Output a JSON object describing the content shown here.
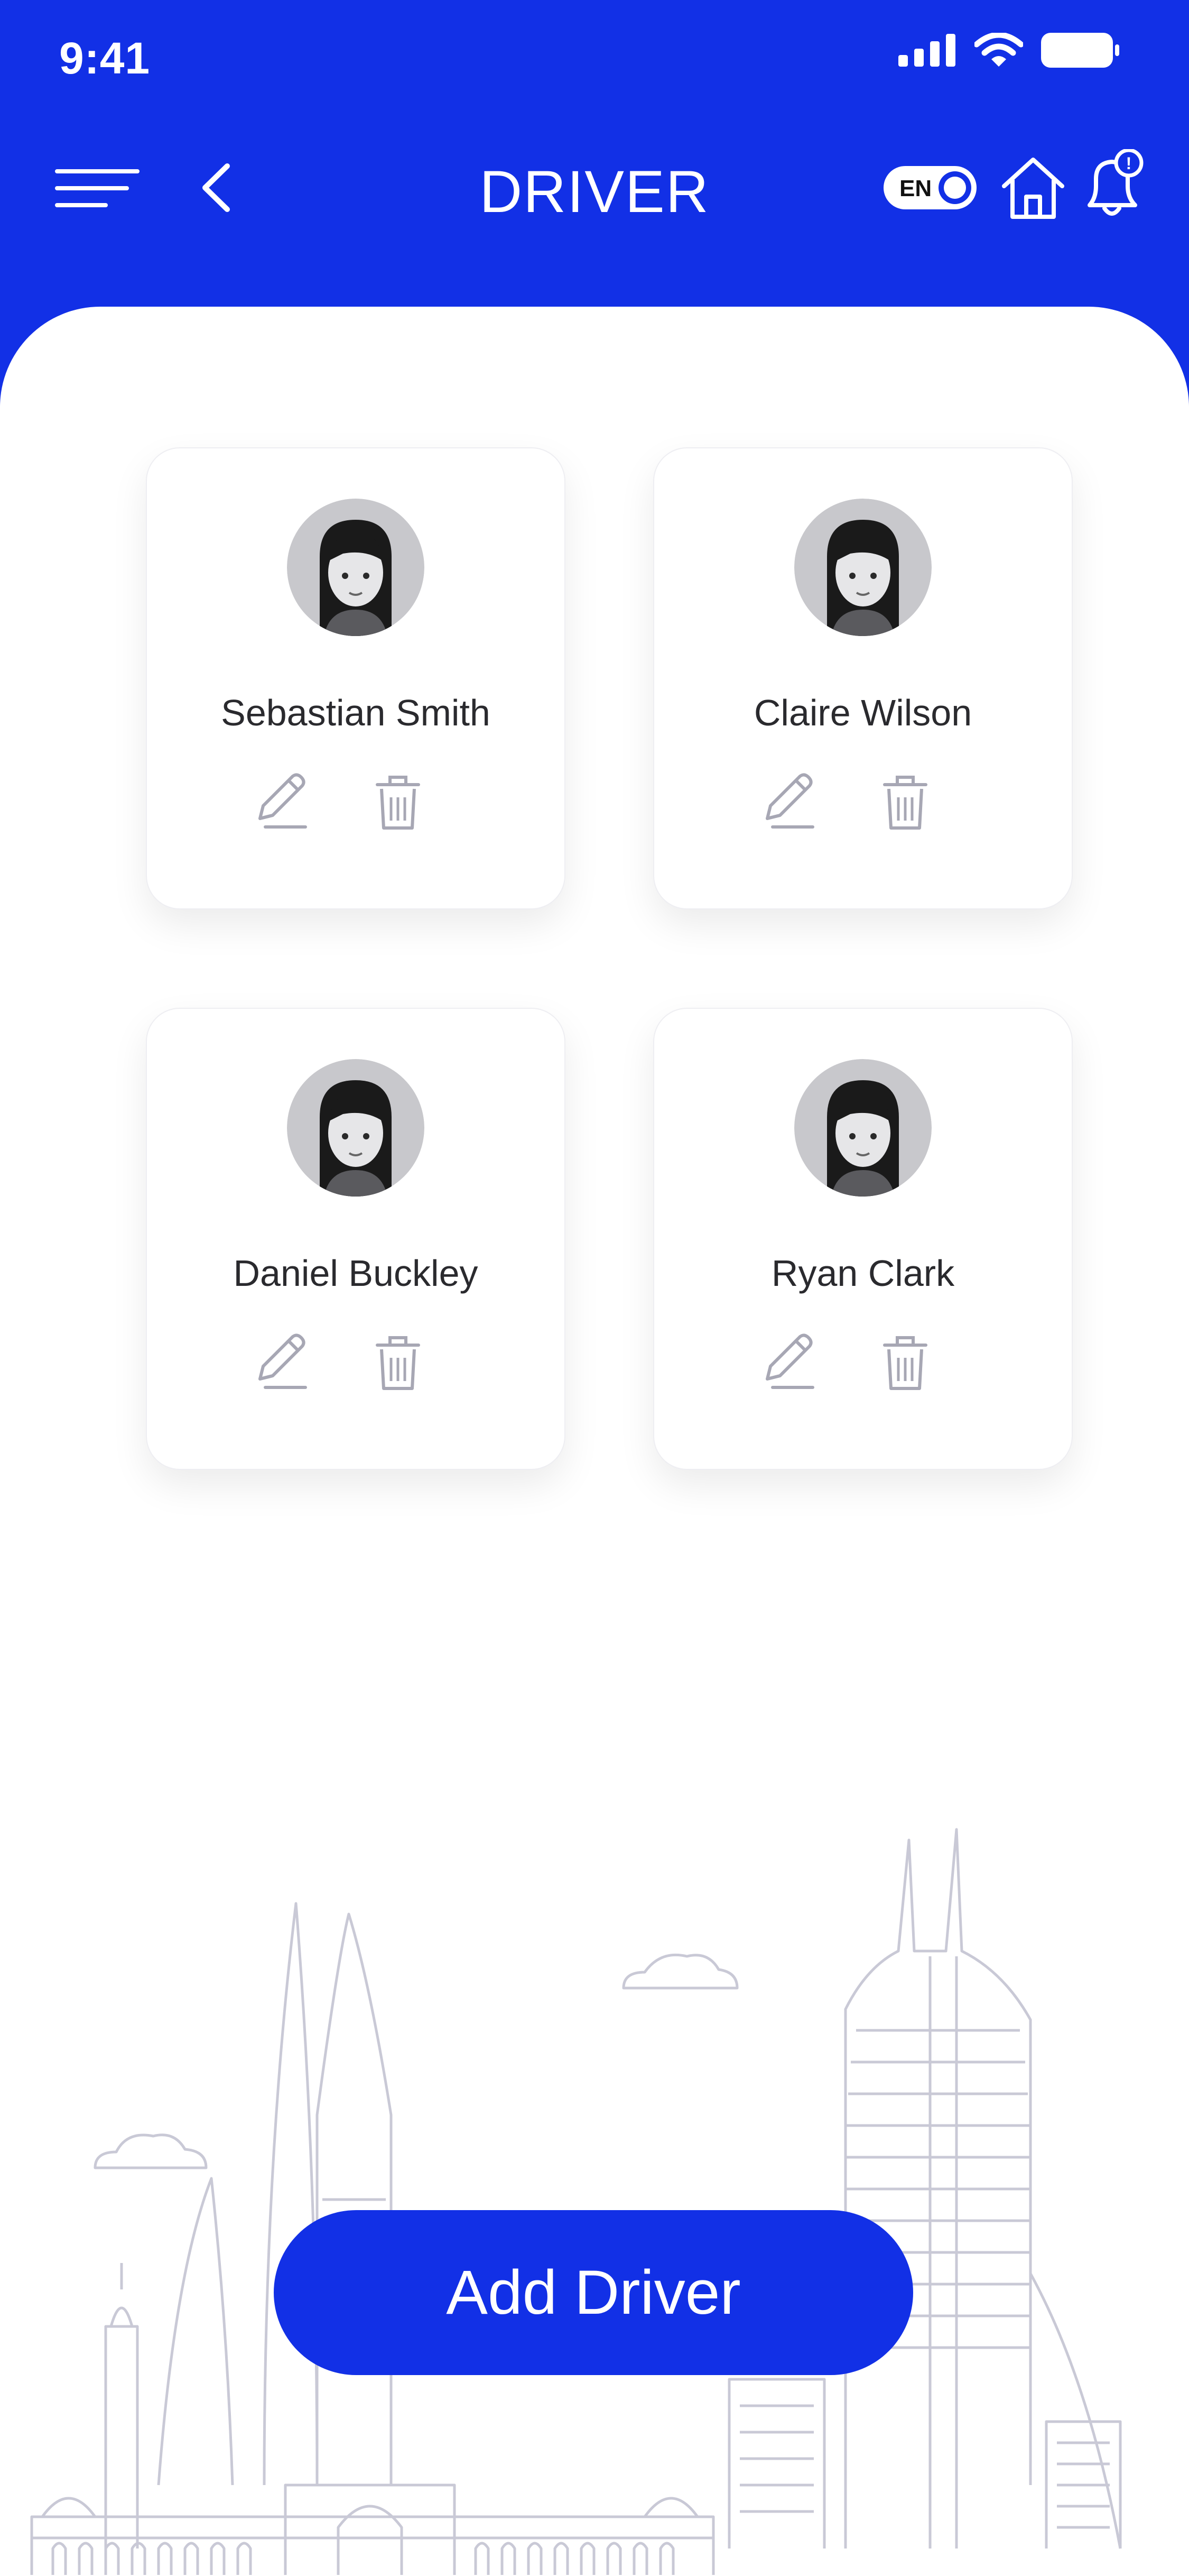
{
  "status_bar": {
    "time": "9:41"
  },
  "header": {
    "title": "DRIVER",
    "language": "EN",
    "notification_badge": "!"
  },
  "drivers": [
    {
      "name": "Sebastian Smith"
    },
    {
      "name": "Claire Wilson"
    },
    {
      "name": "Daniel Buckley"
    },
    {
      "name": "Ryan Clark"
    }
  ],
  "actions": {
    "add_driver_label": "Add Driver"
  },
  "colors": {
    "primary": "#1230e6",
    "icon_gray": "#a7a7b4",
    "text_dark": "#2a2a2e"
  },
  "icons": [
    "menu-icon",
    "back-icon",
    "home-icon",
    "bell-icon",
    "edit-icon",
    "trash-icon",
    "avatar-icon",
    "signal-icon",
    "wifi-icon",
    "battery-icon"
  ]
}
